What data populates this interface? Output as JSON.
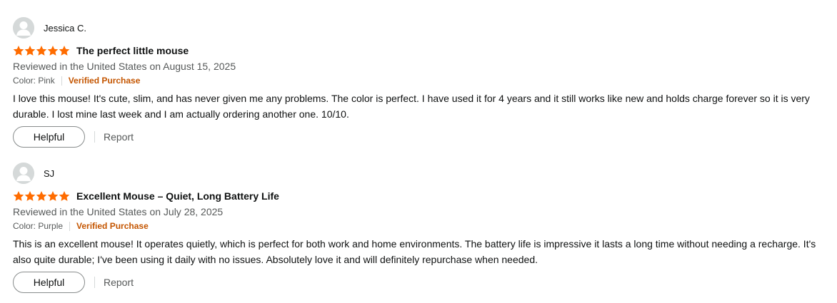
{
  "reviews": [
    {
      "profile_name": "Jessica C.",
      "rating": 5,
      "title": "The perfect little mouse",
      "date": "Reviewed in the United States on August 15, 2025",
      "color": "Color: Pink",
      "verified": "Verified Purchase",
      "body": "I love this mouse! It's cute, slim, and has never given me any problems. The color is perfect. I have used it for 4 years and it still works like new and holds charge forever so it is very durable. I lost mine last week and I am actually ordering another one. 10/10.",
      "helpful_label": "Helpful",
      "report_label": "Report"
    },
    {
      "profile_name": "SJ",
      "rating": 5,
      "title": "Excellent Mouse – Quiet, Long Battery Life",
      "date": "Reviewed in the United States on July 28, 2025",
      "color": "Color: Purple",
      "verified": "Verified Purchase",
      "body": "This is an excellent mouse! It operates quietly, which is perfect for both work and home environments. The battery life is impressive it lasts a long time without needing a recharge. It's also quite durable; I've been using it daily with no issues. Absolutely love it and will definitely repurchase when needed.",
      "helpful_label": "Helpful",
      "report_label": "Report"
    }
  ],
  "colors": {
    "star": "#ff6c00",
    "verified": "#c45500",
    "secondary_text": "#565959"
  },
  "icons": {
    "avatar": "default-user-icon",
    "star": "star-icon"
  }
}
